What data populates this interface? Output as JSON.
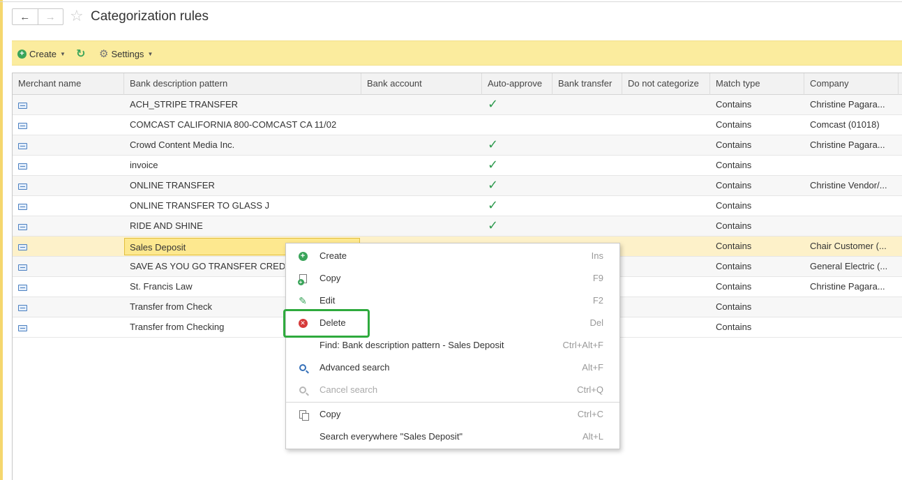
{
  "header": {
    "back_icon": "arrow-left-icon",
    "forward_icon": "arrow-right-icon",
    "favorite_icon": "star-icon",
    "title": "Categorization rules"
  },
  "toolbar": {
    "create_label": "Create",
    "refresh_icon": "refresh-icon",
    "settings_label": "Settings"
  },
  "table": {
    "columns": [
      "Merchant name",
      "Bank description pattern",
      "Bank account",
      "Auto-approve",
      "Bank transfer",
      "Do not categorize",
      "Match type",
      "Company"
    ],
    "rows": [
      {
        "pattern": "ACH_STRIPE TRANSFER",
        "auto_approve": "✓",
        "match": "Contains",
        "company": "Christine Pagara..."
      },
      {
        "pattern": "COMCAST CALIFORNIA 800-COMCAST CA 11/02",
        "auto_approve": "",
        "match": "Contains",
        "company": "Comcast (01018)"
      },
      {
        "pattern": "Crowd Content Media Inc.",
        "auto_approve": "✓",
        "match": "Contains",
        "company": "Christine Pagara..."
      },
      {
        "pattern": "invoice",
        "auto_approve": "✓",
        "match": "Contains",
        "company": ""
      },
      {
        "pattern": "ONLINE TRANSFER",
        "auto_approve": "✓",
        "match": "Contains",
        "company": "Christine Vendor/..."
      },
      {
        "pattern": "ONLINE TRANSFER TO GLASS J",
        "auto_approve": "✓",
        "match": "Contains",
        "company": ""
      },
      {
        "pattern": "RIDE AND SHINE",
        "auto_approve": "✓",
        "match": "Contains",
        "company": ""
      },
      {
        "pattern": "Sales Deposit",
        "auto_approve": "",
        "match": "Contains",
        "company": "Chair Customer (..."
      },
      {
        "pattern": "SAVE AS YOU GO TRANSFER CRED",
        "auto_approve": "",
        "match": "Contains",
        "company": "General Electric (..."
      },
      {
        "pattern": "St. Francis Law",
        "auto_approve": "",
        "match": "Contains",
        "company": "Christine Pagara..."
      },
      {
        "pattern": "Transfer from Check",
        "auto_approve": "",
        "match": "Contains",
        "company": ""
      },
      {
        "pattern": "Transfer from Checking",
        "auto_approve": "",
        "match": "Contains",
        "company": ""
      }
    ],
    "selected_row": 7
  },
  "context_menu": {
    "items": [
      {
        "label": "Create",
        "shortcut": "Ins",
        "icon": "plus-circle-icon"
      },
      {
        "label": "Copy",
        "shortcut": "F9",
        "icon": "copy-record-icon"
      },
      {
        "label": "Edit",
        "shortcut": "F2",
        "icon": "pencil-icon"
      },
      {
        "label": "Delete",
        "shortcut": "Del",
        "icon": "delete-circle-icon"
      },
      {
        "label": "Find: Bank description pattern - Sales Deposit",
        "shortcut": "Ctrl+Alt+F",
        "icon": ""
      },
      {
        "label": "Advanced search",
        "shortcut": "Alt+F",
        "icon": "magnifier-icon"
      },
      {
        "label": "Cancel search",
        "shortcut": "Ctrl+Q",
        "icon": "cancel-search-icon"
      },
      {
        "label": "Copy",
        "shortcut": "Ctrl+C",
        "icon": "clipboard-icon"
      },
      {
        "label": "Search everywhere \"Sales Deposit\"",
        "shortcut": "Alt+L",
        "icon": ""
      }
    ],
    "highlighted_item": "Delete"
  },
  "colors": {
    "toolbar_bg": "#fbec9e",
    "selected_row_bg": "#fdf1c9",
    "check_green": "#2e9a4e",
    "highlight_green": "#2eaa3d"
  }
}
